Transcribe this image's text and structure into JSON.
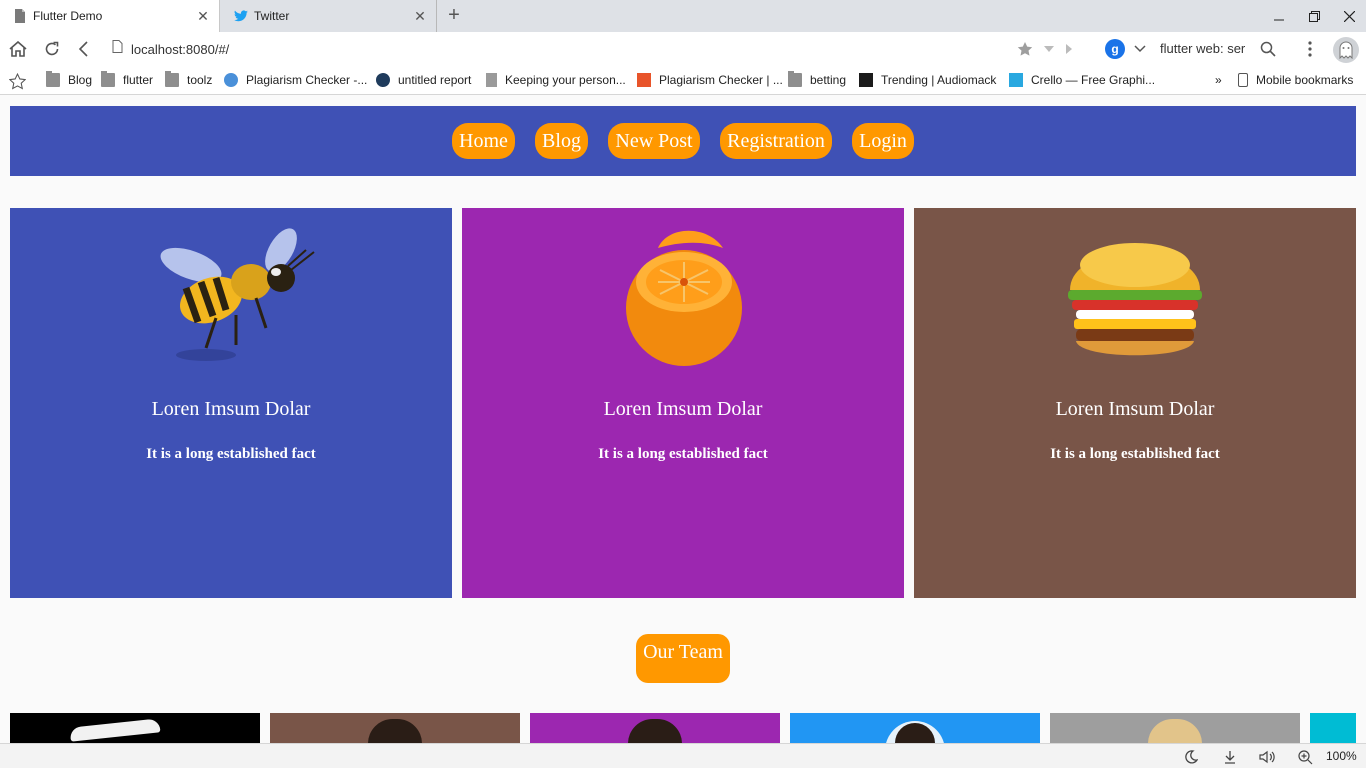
{
  "browser": {
    "tabs": [
      {
        "title": "Flutter Demo",
        "icon": "page-icon"
      },
      {
        "title": "Twitter",
        "icon": "twitter-bird-icon"
      }
    ],
    "url": "localhost:8080/#/",
    "search_text": "flutter web: ser",
    "search_engine_letter": "g",
    "zoom": "100%",
    "bookmarks": [
      {
        "label": "Blog",
        "icon": "folder-icon"
      },
      {
        "label": "flutter",
        "icon": "folder-icon"
      },
      {
        "label": "toolz",
        "icon": "folder-icon"
      },
      {
        "label": "Plagiarism Checker -...",
        "icon": "globe-icon"
      },
      {
        "label": "untitled report",
        "icon": "q-logo-icon"
      },
      {
        "label": "Keeping your person...",
        "icon": "page-icon"
      },
      {
        "label": "Plagiarism Checker | ...",
        "icon": "p-logo-icon"
      },
      {
        "label": "betting",
        "icon": "folder-icon"
      },
      {
        "label": "Trending | Audiomack",
        "icon": "audiomack-icon"
      },
      {
        "label": "Crello — Free Graphi...",
        "icon": "crello-icon"
      }
    ],
    "bookmarks_overflow": "»",
    "mobile_bookmarks": "Mobile bookmarks"
  },
  "nav": {
    "items": [
      "Home",
      "Blog",
      "New Post",
      "Registration",
      "Login"
    ],
    "bar_color": "#3f51b5",
    "button_color": "#ff9800"
  },
  "cards": [
    {
      "title": "Loren Imsum Dolar",
      "subtitle": "It is a long established fact",
      "image": "bee-icon",
      "color": "#3f51b5"
    },
    {
      "title": "Loren Imsum Dolar",
      "subtitle": "It is a long established fact",
      "image": "orange-icon",
      "color": "#9c27b0"
    },
    {
      "title": "Loren Imsum Dolar",
      "subtitle": "It is a long established fact",
      "image": "burger-icon",
      "color": "#795548"
    }
  ],
  "team": {
    "button_label": "Our Team",
    "member_colors": [
      "#000000",
      "#795548",
      "#9c27b0",
      "#2196f3",
      "#9e9e9e",
      "#00bcd4"
    ]
  }
}
